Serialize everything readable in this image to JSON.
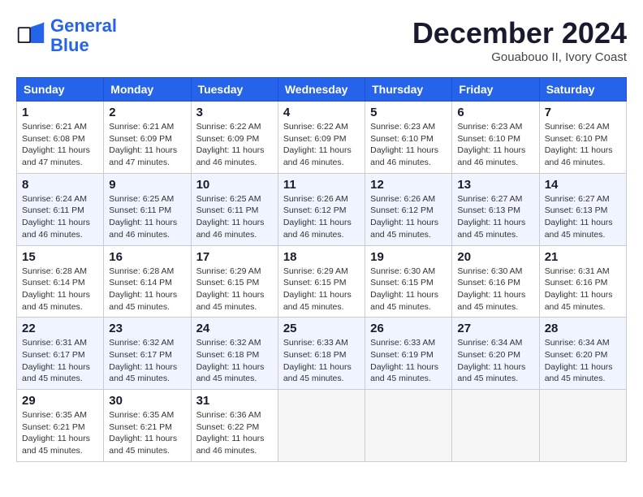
{
  "header": {
    "logo_line1": "General",
    "logo_line2": "Blue",
    "month": "December 2024",
    "location": "Gouabouo II, Ivory Coast"
  },
  "weekdays": [
    "Sunday",
    "Monday",
    "Tuesday",
    "Wednesday",
    "Thursday",
    "Friday",
    "Saturday"
  ],
  "weeks": [
    [
      {
        "date": "1",
        "sunrise": "Sunrise: 6:21 AM",
        "sunset": "Sunset: 6:08 PM",
        "daylight": "Daylight: 11 hours and 47 minutes."
      },
      {
        "date": "2",
        "sunrise": "Sunrise: 6:21 AM",
        "sunset": "Sunset: 6:09 PM",
        "daylight": "Daylight: 11 hours and 47 minutes."
      },
      {
        "date": "3",
        "sunrise": "Sunrise: 6:22 AM",
        "sunset": "Sunset: 6:09 PM",
        "daylight": "Daylight: 11 hours and 46 minutes."
      },
      {
        "date": "4",
        "sunrise": "Sunrise: 6:22 AM",
        "sunset": "Sunset: 6:09 PM",
        "daylight": "Daylight: 11 hours and 46 minutes."
      },
      {
        "date": "5",
        "sunrise": "Sunrise: 6:23 AM",
        "sunset": "Sunset: 6:10 PM",
        "daylight": "Daylight: 11 hours and 46 minutes."
      },
      {
        "date": "6",
        "sunrise": "Sunrise: 6:23 AM",
        "sunset": "Sunset: 6:10 PM",
        "daylight": "Daylight: 11 hours and 46 minutes."
      },
      {
        "date": "7",
        "sunrise": "Sunrise: 6:24 AM",
        "sunset": "Sunset: 6:10 PM",
        "daylight": "Daylight: 11 hours and 46 minutes."
      }
    ],
    [
      {
        "date": "8",
        "sunrise": "Sunrise: 6:24 AM",
        "sunset": "Sunset: 6:11 PM",
        "daylight": "Daylight: 11 hours and 46 minutes."
      },
      {
        "date": "9",
        "sunrise": "Sunrise: 6:25 AM",
        "sunset": "Sunset: 6:11 PM",
        "daylight": "Daylight: 11 hours and 46 minutes."
      },
      {
        "date": "10",
        "sunrise": "Sunrise: 6:25 AM",
        "sunset": "Sunset: 6:11 PM",
        "daylight": "Daylight: 11 hours and 46 minutes."
      },
      {
        "date": "11",
        "sunrise": "Sunrise: 6:26 AM",
        "sunset": "Sunset: 6:12 PM",
        "daylight": "Daylight: 11 hours and 46 minutes."
      },
      {
        "date": "12",
        "sunrise": "Sunrise: 6:26 AM",
        "sunset": "Sunset: 6:12 PM",
        "daylight": "Daylight: 11 hours and 45 minutes."
      },
      {
        "date": "13",
        "sunrise": "Sunrise: 6:27 AM",
        "sunset": "Sunset: 6:13 PM",
        "daylight": "Daylight: 11 hours and 45 minutes."
      },
      {
        "date": "14",
        "sunrise": "Sunrise: 6:27 AM",
        "sunset": "Sunset: 6:13 PM",
        "daylight": "Daylight: 11 hours and 45 minutes."
      }
    ],
    [
      {
        "date": "15",
        "sunrise": "Sunrise: 6:28 AM",
        "sunset": "Sunset: 6:14 PM",
        "daylight": "Daylight: 11 hours and 45 minutes."
      },
      {
        "date": "16",
        "sunrise": "Sunrise: 6:28 AM",
        "sunset": "Sunset: 6:14 PM",
        "daylight": "Daylight: 11 hours and 45 minutes."
      },
      {
        "date": "17",
        "sunrise": "Sunrise: 6:29 AM",
        "sunset": "Sunset: 6:15 PM",
        "daylight": "Daylight: 11 hours and 45 minutes."
      },
      {
        "date": "18",
        "sunrise": "Sunrise: 6:29 AM",
        "sunset": "Sunset: 6:15 PM",
        "daylight": "Daylight: 11 hours and 45 minutes."
      },
      {
        "date": "19",
        "sunrise": "Sunrise: 6:30 AM",
        "sunset": "Sunset: 6:15 PM",
        "daylight": "Daylight: 11 hours and 45 minutes."
      },
      {
        "date": "20",
        "sunrise": "Sunrise: 6:30 AM",
        "sunset": "Sunset: 6:16 PM",
        "daylight": "Daylight: 11 hours and 45 minutes."
      },
      {
        "date": "21",
        "sunrise": "Sunrise: 6:31 AM",
        "sunset": "Sunset: 6:16 PM",
        "daylight": "Daylight: 11 hours and 45 minutes."
      }
    ],
    [
      {
        "date": "22",
        "sunrise": "Sunrise: 6:31 AM",
        "sunset": "Sunset: 6:17 PM",
        "daylight": "Daylight: 11 hours and 45 minutes."
      },
      {
        "date": "23",
        "sunrise": "Sunrise: 6:32 AM",
        "sunset": "Sunset: 6:17 PM",
        "daylight": "Daylight: 11 hours and 45 minutes."
      },
      {
        "date": "24",
        "sunrise": "Sunrise: 6:32 AM",
        "sunset": "Sunset: 6:18 PM",
        "daylight": "Daylight: 11 hours and 45 minutes."
      },
      {
        "date": "25",
        "sunrise": "Sunrise: 6:33 AM",
        "sunset": "Sunset: 6:18 PM",
        "daylight": "Daylight: 11 hours and 45 minutes."
      },
      {
        "date": "26",
        "sunrise": "Sunrise: 6:33 AM",
        "sunset": "Sunset: 6:19 PM",
        "daylight": "Daylight: 11 hours and 45 minutes."
      },
      {
        "date": "27",
        "sunrise": "Sunrise: 6:34 AM",
        "sunset": "Sunset: 6:20 PM",
        "daylight": "Daylight: 11 hours and 45 minutes."
      },
      {
        "date": "28",
        "sunrise": "Sunrise: 6:34 AM",
        "sunset": "Sunset: 6:20 PM",
        "daylight": "Daylight: 11 hours and 45 minutes."
      }
    ],
    [
      {
        "date": "29",
        "sunrise": "Sunrise: 6:35 AM",
        "sunset": "Sunset: 6:21 PM",
        "daylight": "Daylight: 11 hours and 45 minutes."
      },
      {
        "date": "30",
        "sunrise": "Sunrise: 6:35 AM",
        "sunset": "Sunset: 6:21 PM",
        "daylight": "Daylight: 11 hours and 45 minutes."
      },
      {
        "date": "31",
        "sunrise": "Sunrise: 6:36 AM",
        "sunset": "Sunset: 6:22 PM",
        "daylight": "Daylight: 11 hours and 46 minutes."
      },
      null,
      null,
      null,
      null
    ]
  ]
}
